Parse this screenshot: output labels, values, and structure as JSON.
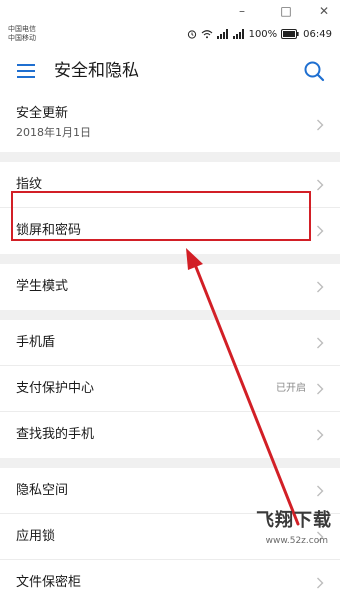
{
  "window_controls": {
    "minimize": "–",
    "maximize": "□",
    "close": "✕"
  },
  "status": {
    "carrier1": "中国电信",
    "carrier2": "中国移动",
    "battery": "100%",
    "time": "06:49"
  },
  "header": {
    "title": "安全和隐私"
  },
  "groups": [
    [
      {
        "label": "安全更新",
        "sub": "2018年1月1日"
      }
    ],
    [
      {
        "label": "指纹"
      },
      {
        "label": "锁屏和密码"
      }
    ],
    [
      {
        "label": "学生模式"
      }
    ],
    [
      {
        "label": "手机盾"
      },
      {
        "label": "支付保护中心",
        "value": "已开启"
      },
      {
        "label": "查找我的手机"
      }
    ],
    [
      {
        "label": "隐私空间"
      },
      {
        "label": "应用锁"
      },
      {
        "label": "文件保密柜"
      }
    ]
  ],
  "watermark": {
    "logo": "飞翔下载",
    "url": "www.52z.com"
  },
  "colors": {
    "annotation": "#d21f26",
    "accent": "#1f6fd0"
  }
}
